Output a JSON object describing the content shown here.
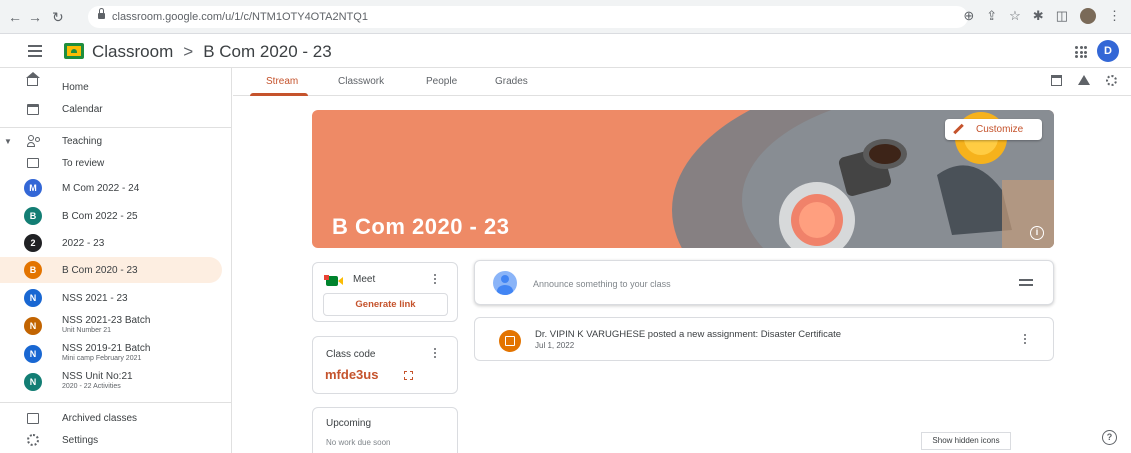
{
  "browser": {
    "url": "classroom.google.com/u/1/c/NTM1OTY4OTA2NTQ1",
    "back_icon": "arrow-left-icon",
    "forward_icon": "arrow-right-icon",
    "reload_icon": "reload-icon"
  },
  "header": {
    "app_name": "Classroom",
    "separator": ">",
    "class_name": "B Com 2020 - 23",
    "user_initial": "D",
    "colors": {
      "avatar": "#3367d6",
      "logo": "#1e8e3e"
    }
  },
  "sidebar": {
    "home": "Home",
    "calendar": "Calendar",
    "teaching": "Teaching",
    "to_review": "To review",
    "classes": [
      {
        "initial": "M",
        "label": "M Com 2022 - 24",
        "sub": "",
        "color": "#3367d6"
      },
      {
        "initial": "B",
        "label": "B Com 2022 - 25",
        "sub": "",
        "color": "#137e74"
      },
      {
        "initial": "2",
        "label": "2022 - 23",
        "sub": "",
        "color": "#202124"
      },
      {
        "initial": "B",
        "label": "B Com 2020 - 23",
        "sub": "",
        "color": "#e37400"
      },
      {
        "initial": "N",
        "label": "NSS 2021 - 23",
        "sub": "",
        "color": "#1967d2"
      },
      {
        "initial": "N",
        "label": "NSS 2021-23 Batch",
        "sub": "Unit Number 21",
        "color": "#c26401"
      },
      {
        "initial": "N",
        "label": "NSS 2019-21 Batch",
        "sub": "Mini camp February 2021",
        "color": "#1967d2"
      },
      {
        "initial": "N",
        "label": "NSS Unit No:21",
        "sub": "2020 - 22 Activities",
        "color": "#137e74"
      }
    ],
    "archived": "Archived classes",
    "settings": "Settings"
  },
  "tabs": {
    "stream": "Stream",
    "classwork": "Classwork",
    "people": "People",
    "grades": "Grades",
    "active_color": "#c5532c"
  },
  "banner": {
    "title": "B Com 2020 - 23",
    "customize": "Customize",
    "color": "#ee8a66"
  },
  "meet": {
    "title": "Meet",
    "generate": "Generate link"
  },
  "class_code": {
    "title": "Class code",
    "code": "mfde3us"
  },
  "upcoming": {
    "title": "Upcoming",
    "empty": "No work due soon"
  },
  "announce": {
    "placeholder": "Announce something to your class"
  },
  "post": {
    "text": "Dr. VIPIN K VARUGHESE posted a new assignment: Disaster Certificate",
    "date": "Jul 1, 2022"
  },
  "footer": {
    "tooltip": "Show hidden icons",
    "help": "?"
  }
}
